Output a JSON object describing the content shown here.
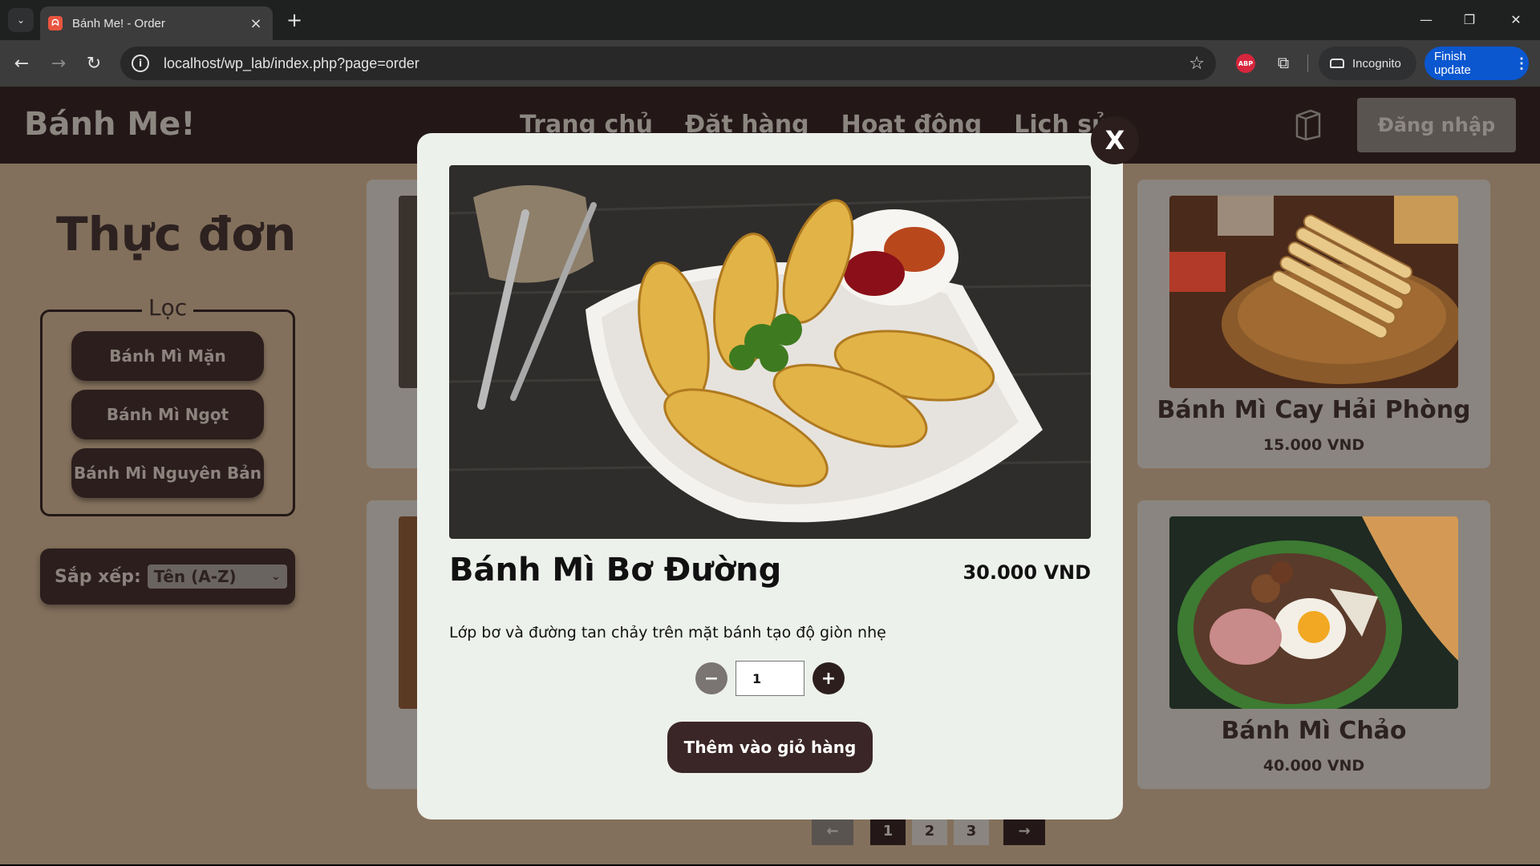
{
  "browser": {
    "tab_title": "Bánh Me! - Order",
    "url": "localhost/wp_lab/index.php?page=order",
    "incognito_label": "Incognito",
    "finish_update_label": "Finish update",
    "abp_label": "ABP"
  },
  "header": {
    "brand": "Bánh Me!",
    "nav": [
      "Trang chủ",
      "Đặt hàng",
      "Hoạt động",
      "Lịch sử"
    ],
    "login_label": "Đăng nhập"
  },
  "sidebar": {
    "menu_title": "Thực đơn",
    "filter_legend": "Lọc",
    "filters": [
      "Bánh Mì Mặn",
      "Bánh Mì Ngọt",
      "Bánh Mì Nguyên Bản"
    ],
    "sort_label": "Sắp xếp:",
    "sort_value": "Tên (A-Z)"
  },
  "products": [
    {
      "name": "Bánh Mì Cay Hải Phòng",
      "price": "15.000 VND"
    },
    {
      "name": "Bánh Mì Chảo",
      "price": "40.000 VND"
    }
  ],
  "pagination": {
    "prev": "←",
    "pages": [
      "1",
      "2",
      "3"
    ],
    "next": "→",
    "current": "1"
  },
  "modal": {
    "close_label": "X",
    "title": "Bánh Mì Bơ Đường",
    "price": "30.000 VND",
    "description": "Lớp bơ và đường tan chảy trên mặt bánh tạo độ giòn nhẹ",
    "quantity": "1",
    "minus_label": "−",
    "plus_label": "+",
    "add_to_cart_label": "Thêm vào giỏ hàng"
  },
  "colors": {
    "page_bg": "#83705c",
    "header_bg": "#231817",
    "modal_bg": "#edf1eb",
    "primary_button": "#3a2626",
    "browser_accent": "#0b57d0"
  }
}
